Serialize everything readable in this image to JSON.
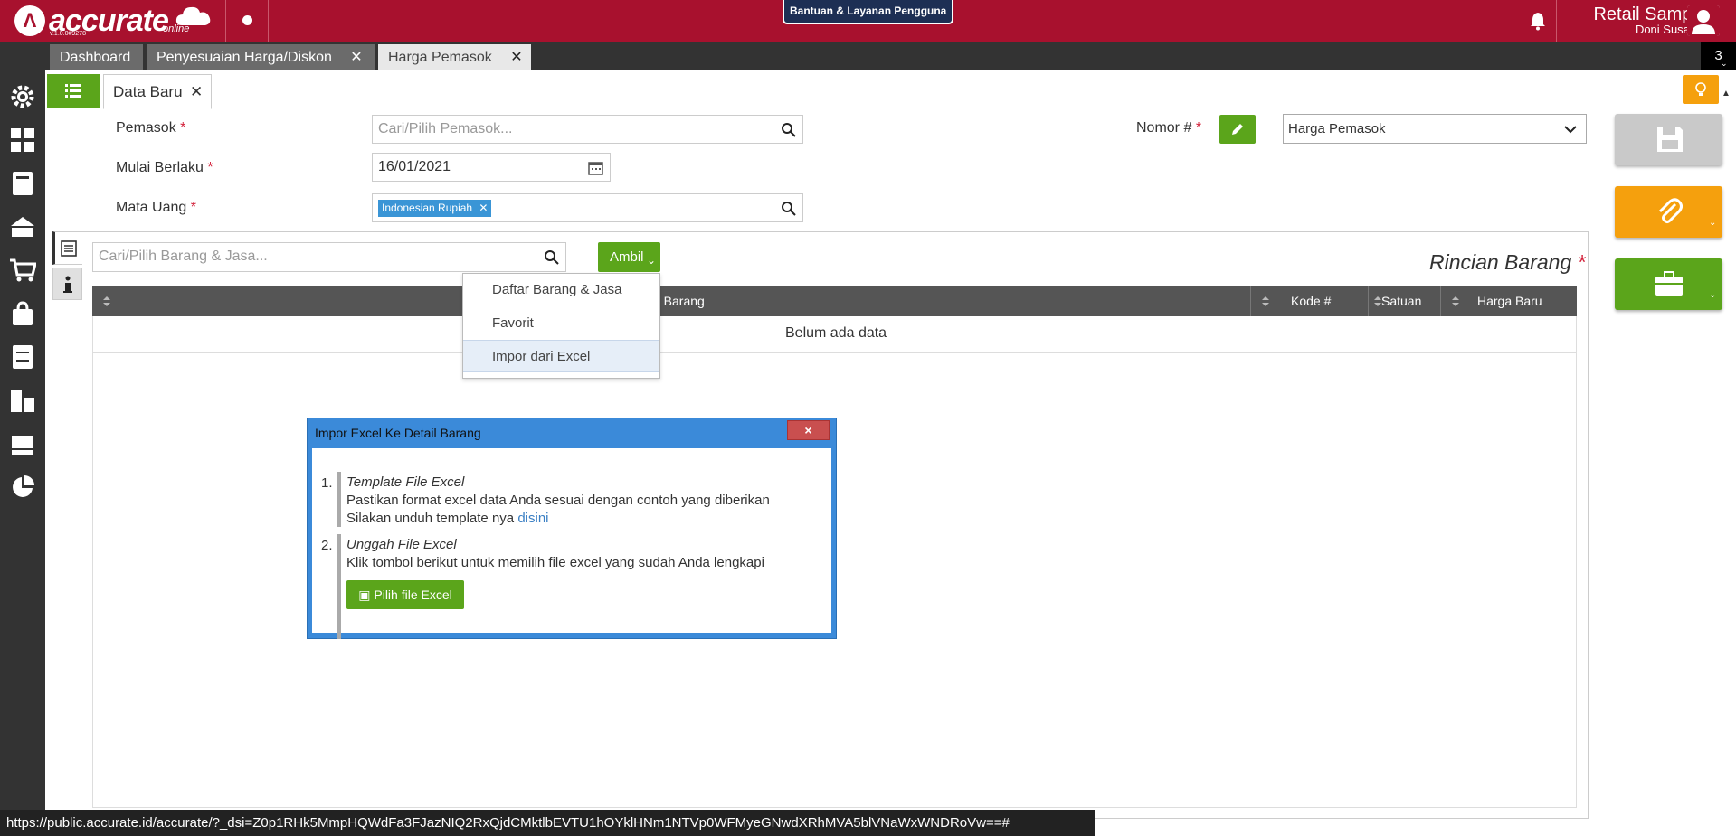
{
  "app": {
    "logo_text": "accurate",
    "logo_sub": "online",
    "version": "v.1.0.0#9278",
    "help_label": "Bantuan & Layanan Pengguna",
    "company": "Retail Sample",
    "user": "Doni Susanto",
    "accent": "#a8112e"
  },
  "tabs": [
    {
      "label": "Dashboard"
    },
    {
      "label": "Penyesuaian Harga/Diskon"
    },
    {
      "label": "Harga Pemasok"
    }
  ],
  "tab_count": "3",
  "subtab": {
    "label": "Data Baru"
  },
  "form": {
    "pemasok_label": "Pemasok",
    "pemasok_placeholder": "Cari/Pilih Pemasok...",
    "mulai_label": "Mulai Berlaku",
    "mulai_value": "16/01/2021",
    "mata_uang_label": "Mata Uang",
    "mata_uang_chip": "Indonesian Rupiah",
    "nomor_label": "Nomor #",
    "nomor_select": "Harga Pemasok",
    "required_mark": "*"
  },
  "detail": {
    "search_placeholder": "Cari/Pilih Barang & Jasa...",
    "ambil_label": "Ambil",
    "title": "Rincian Barang",
    "columns": [
      "a Barang",
      "Kode #",
      "Satuan",
      "Harga Baru"
    ],
    "empty": "Belum ada data"
  },
  "ambil_menu": [
    {
      "label": "Daftar Barang & Jasa"
    },
    {
      "label": "Favorit"
    },
    {
      "label": "Impor dari Excel"
    }
  ],
  "dialog": {
    "title": "Impor Excel Ke Detail Barang",
    "close": "×",
    "step1_num": "1.",
    "step1_title": "Template File Excel",
    "step1_text": "Pastikan format excel data Anda sesuai dengan contoh yang diberikan",
    "step1_text2": "Silakan unduh template nya",
    "step1_link": "disini",
    "step2_num": "2.",
    "step2_title": "Unggah File Excel",
    "step2_text": "Klik tombol berikut untuk memilih file excel yang sudah Anda lengkapi",
    "pick_button": "Pilih file Excel"
  },
  "status_url": "https://public.accurate.id/accurate/?_dsi=Z0p1RHk5MmpHQWdFa3FJazNIQ2RxQjdCMktlbEVTU1hOYklHNm1NTVp0WFMyeGNwdXRhMVA5blVNaWxWNDRoVw==#"
}
